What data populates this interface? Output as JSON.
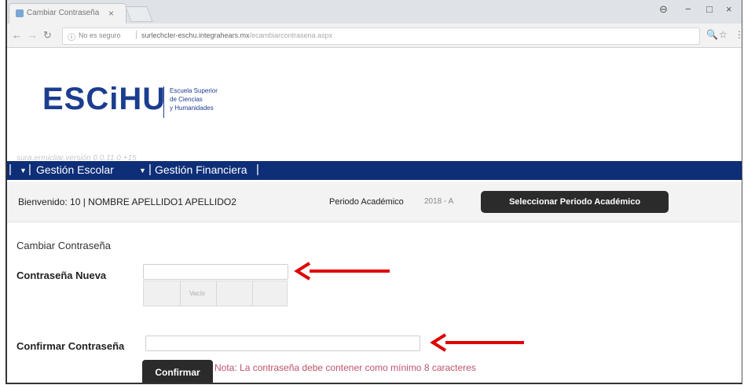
{
  "browser": {
    "tab_title": "Cambiar Contraseña",
    "tab_close": "×",
    "omnibox": {
      "security_label": "No es seguro",
      "url_host": "surlechcler-eschu.integrahears.mx",
      "url_path": "/ecambiarcontrasena.aspx"
    },
    "window_controls": [
      "⊖",
      "−",
      "□",
      "×"
    ]
  },
  "header": {
    "logo_text": "ESCiHU",
    "logo_tagline": [
      "Escuela Superior",
      "de Ciencias",
      "y Humanidades"
    ],
    "version_text": "sura.ermicliar.versión 0.0.11.0.+15"
  },
  "nav": {
    "items": [
      "Gestión Escolar",
      "Gestión Financiera"
    ]
  },
  "welcome_bar": {
    "welcome_text": "Bienvenido: 10 | NOMBRE APELLIDO1 APELLIDO2",
    "period_label": "Periodo Académico",
    "period_value": "2018 - A",
    "select_period_button": "Seleccionar Periodo Académico"
  },
  "form": {
    "section_title": "Cambiar Contraseña",
    "new_password_label": "Contraseña Nueva",
    "new_password_value": "",
    "strength_text": "Vacío",
    "confirm_password_label": "Confirmar Contraseña",
    "confirm_password_value": "",
    "confirm_button": "Confirmar",
    "note": "Nota: La contraseña debe contener como mínimo 8 caracteres"
  },
  "colors": {
    "nav_bg": "#0e2e78",
    "logo_blue": "#1c3d8f",
    "button_dark": "#2b2b2b",
    "note_color": "#c0526e",
    "arrow_red": "#e00000"
  }
}
